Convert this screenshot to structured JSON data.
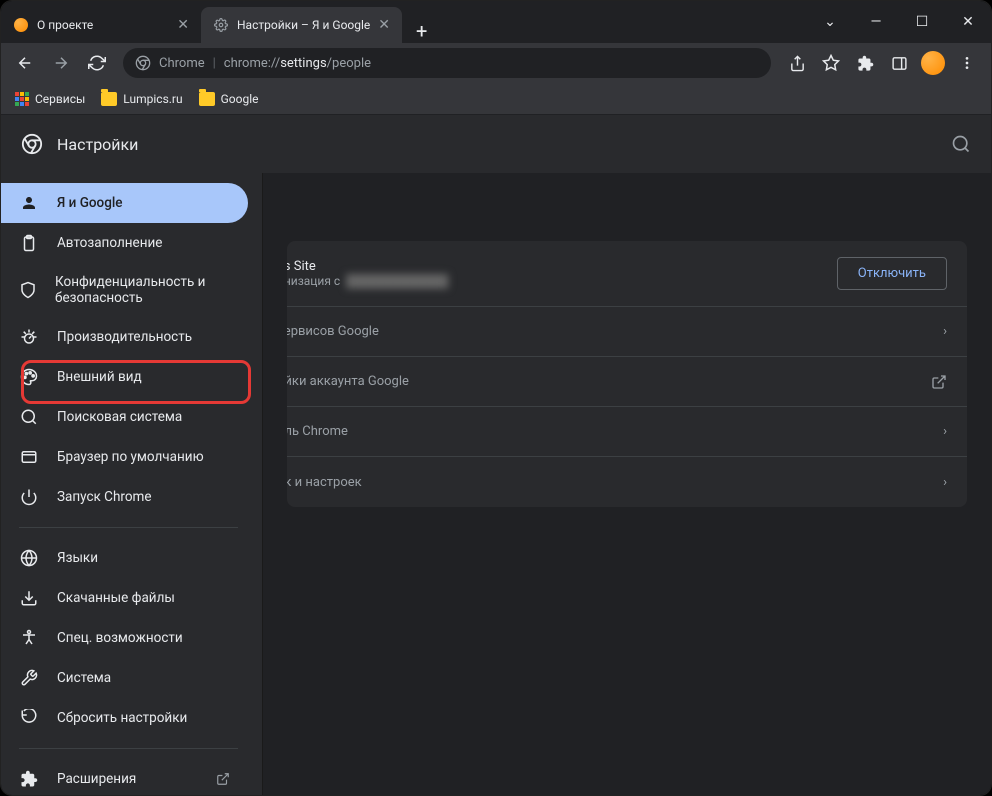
{
  "tabs": [
    {
      "title": "О проекте",
      "active": false
    },
    {
      "title": "Настройки – Я и Google",
      "active": true
    }
  ],
  "omnibox": {
    "origin_label": "Chrome",
    "url_prefix": "chrome://",
    "url_bold": "settings",
    "url_suffix": "/people"
  },
  "bookmarks": {
    "apps": "Сервисы",
    "items": [
      "Lumpics.ru",
      "Google"
    ]
  },
  "settings_title": "Настройки",
  "sidebar": {
    "groups": [
      [
        {
          "icon": "person",
          "label": "Я и Google",
          "selected": true
        },
        {
          "icon": "clipboard",
          "label": "Автозаполнение"
        },
        {
          "icon": "shield",
          "label": "Конфиденциальность и безопасность"
        },
        {
          "icon": "speed",
          "label": "Производительность"
        },
        {
          "icon": "palette",
          "label": "Внешний вид",
          "highlighted": true
        },
        {
          "icon": "search",
          "label": "Поисковая система"
        },
        {
          "icon": "browser",
          "label": "Браузер по умолчанию"
        },
        {
          "icon": "power",
          "label": "Запуск Chrome"
        }
      ],
      [
        {
          "icon": "globe",
          "label": "Языки"
        },
        {
          "icon": "download",
          "label": "Скачанные файлы"
        },
        {
          "icon": "accessibility",
          "label": "Спец. возможности"
        },
        {
          "icon": "wrench",
          "label": "Система"
        },
        {
          "icon": "reset",
          "label": "Сбросить настройки"
        }
      ],
      [
        {
          "icon": "extension",
          "label": "Расширения",
          "external": true
        }
      ]
    ]
  },
  "main": {
    "profile_name": "cs Site",
    "sync_text": "онизация с",
    "disable_btn": "Отключить",
    "rows": [
      "сервисов Google",
      "ойки аккаунта Google",
      "иль Chrome",
      "ок и настроек"
    ]
  }
}
